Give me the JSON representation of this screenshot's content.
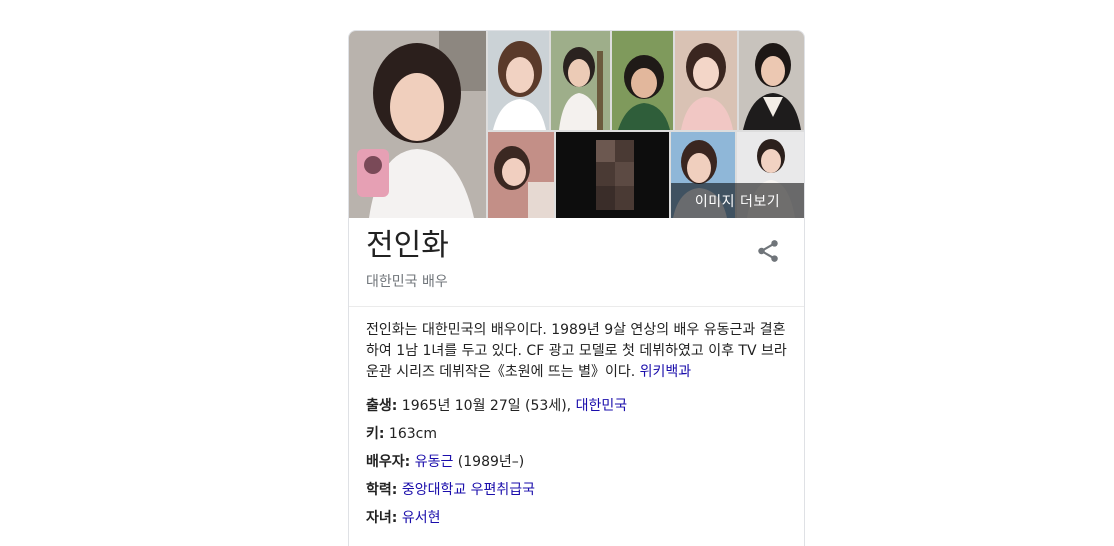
{
  "images": {
    "more_label": "이미지 더보기"
  },
  "entity": {
    "title": "전인화",
    "subtitle": "대한민국 배우"
  },
  "description": {
    "text": "전인화는 대한민국의 배우이다. 1989년 9살 연상의 배우 유동근과 결혼하여 1남 1녀를 두고 있다. CF 광고 모델로 첫 데뷔하였고 이후 TV 브라운관 시리즈 데뷔작은《초원에 뜨는 별》이다. ",
    "source_link": "위키백과"
  },
  "facts": {
    "born": {
      "label": "출생:",
      "value": " 1965년 10월 27일 (53세), ",
      "link": "대한민국"
    },
    "height": {
      "label": "키:",
      "value": " 163cm"
    },
    "spouse": {
      "label": "배우자:",
      "link": "유동근",
      "value": " (1989년–)"
    },
    "education": {
      "label": "학력:",
      "link": "중앙대학교 우편취급국"
    },
    "children": {
      "label": "자녀:",
      "link": "유서현"
    }
  },
  "icons": {
    "share": "share-icon"
  }
}
